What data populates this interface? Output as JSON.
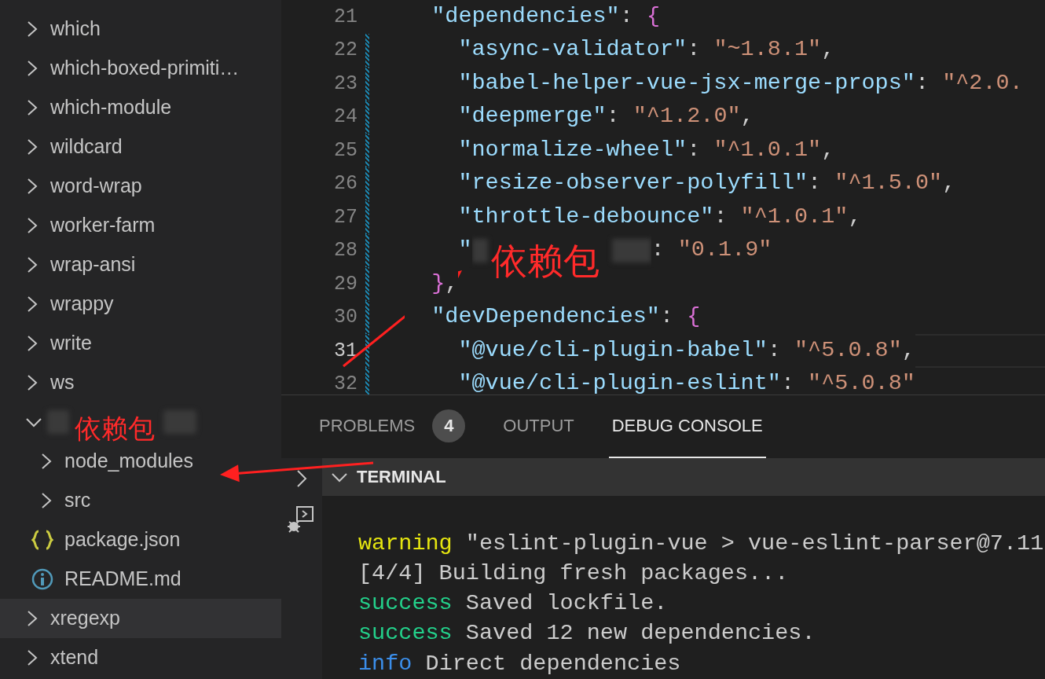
{
  "sidebar": {
    "items": [
      {
        "kind": "folder",
        "label": "which",
        "expanded": false,
        "selected": false
      },
      {
        "kind": "folder",
        "label": "which-boxed-primiti…",
        "expanded": false,
        "selected": false
      },
      {
        "kind": "folder",
        "label": "which-module",
        "expanded": false,
        "selected": false
      },
      {
        "kind": "folder",
        "label": "wildcard",
        "expanded": false,
        "selected": false
      },
      {
        "kind": "folder",
        "label": "word-wrap",
        "expanded": false,
        "selected": false
      },
      {
        "kind": "folder",
        "label": "worker-farm",
        "expanded": false,
        "selected": false
      },
      {
        "kind": "folder",
        "label": "wrap-ansi",
        "expanded": false,
        "selected": false
      },
      {
        "kind": "folder",
        "label": "wrappy",
        "expanded": false,
        "selected": false
      },
      {
        "kind": "folder",
        "label": "write",
        "expanded": false,
        "selected": false
      },
      {
        "kind": "folder",
        "label": "ws",
        "expanded": false,
        "selected": false
      },
      {
        "kind": "redacted",
        "expanded": true,
        "selected": false,
        "children": [
          {
            "kind": "folder",
            "label": "node_modules",
            "expanded": false,
            "selected": false
          },
          {
            "kind": "folder",
            "label": "src",
            "expanded": false,
            "selected": false
          },
          {
            "kind": "json",
            "label": "package.json",
            "selected": false
          },
          {
            "kind": "info",
            "label": "README.md",
            "selected": false
          }
        ]
      },
      {
        "kind": "folder",
        "label": "xregexp",
        "expanded": false,
        "selected": true
      },
      {
        "kind": "folder",
        "label": "xtend",
        "expanded": false,
        "selected": false
      }
    ]
  },
  "editor": {
    "lines": [
      {
        "number": "21",
        "current": false,
        "modified": false,
        "tokens": [
          {
            "kind": "key",
            "text": "  \"dependencies\""
          },
          {
            "kind": "punct",
            "text": ": "
          },
          {
            "kind": "brace",
            "text": "{"
          }
        ]
      },
      {
        "number": "22",
        "current": false,
        "modified": true,
        "tokens": [
          {
            "kind": "key",
            "text": "    \"async-validator\""
          },
          {
            "kind": "punct",
            "text": ": "
          },
          {
            "kind": "string",
            "text": "\"~1.8.1\""
          },
          {
            "kind": "punct",
            "text": ","
          }
        ]
      },
      {
        "number": "23",
        "current": false,
        "modified": true,
        "tokens": [
          {
            "kind": "key",
            "text": "    \"babel-helper-vue-jsx-merge-props\""
          },
          {
            "kind": "punct",
            "text": ": "
          },
          {
            "kind": "string",
            "text": "\"^2.0."
          }
        ]
      },
      {
        "number": "24",
        "current": false,
        "modified": true,
        "tokens": [
          {
            "kind": "key",
            "text": "    \"deepmerge\""
          },
          {
            "kind": "punct",
            "text": ": "
          },
          {
            "kind": "string",
            "text": "\"^1.2.0\""
          },
          {
            "kind": "punct",
            "text": ","
          }
        ]
      },
      {
        "number": "25",
        "current": false,
        "modified": true,
        "tokens": [
          {
            "kind": "key",
            "text": "    \"normalize-wheel\""
          },
          {
            "kind": "punct",
            "text": ": "
          },
          {
            "kind": "string",
            "text": "\"^1.0.1\""
          },
          {
            "kind": "punct",
            "text": ","
          }
        ]
      },
      {
        "number": "26",
        "current": false,
        "modified": true,
        "tokens": [
          {
            "kind": "key",
            "text": "    \"resize-observer-polyfill\""
          },
          {
            "kind": "punct",
            "text": ": "
          },
          {
            "kind": "string",
            "text": "\"^1.5.0\""
          },
          {
            "kind": "punct",
            "text": ","
          }
        ]
      },
      {
        "number": "27",
        "current": false,
        "modified": true,
        "tokens": [
          {
            "kind": "key",
            "text": "    \"throttle-debounce\""
          },
          {
            "kind": "punct",
            "text": ": "
          },
          {
            "kind": "string",
            "text": "\"^1.0.1\""
          },
          {
            "kind": "punct",
            "text": ","
          }
        ]
      },
      {
        "number": "28",
        "current": false,
        "modified": true,
        "tokens": [
          {
            "kind": "key",
            "text": "    \""
          },
          {
            "kind": "redacted"
          },
          {
            "kind": "punct",
            "text": ": "
          },
          {
            "kind": "string",
            "text": "\"0.1.9\""
          }
        ]
      },
      {
        "number": "29",
        "current": false,
        "modified": true,
        "tokens": [
          {
            "kind": "brace",
            "text": "  }"
          },
          {
            "kind": "punct",
            "text": ","
          }
        ]
      },
      {
        "number": "30",
        "current": false,
        "modified": true,
        "tokens": [
          {
            "kind": "key",
            "text": "  \"devDependencies\""
          },
          {
            "kind": "punct",
            "text": ": "
          },
          {
            "kind": "brace",
            "text": "{"
          }
        ]
      },
      {
        "number": "31",
        "current": true,
        "modified": true,
        "tokens": [
          {
            "kind": "key",
            "text": "    \"@vue/cli-plugin-babel\""
          },
          {
            "kind": "punct",
            "text": ": "
          },
          {
            "kind": "string",
            "text": "\"^5.0.8\""
          },
          {
            "kind": "punct",
            "text": ","
          }
        ]
      },
      {
        "number": "32",
        "current": false,
        "modified": true,
        "tokens": [
          {
            "kind": "key",
            "text": "    \"@vue/cli-plugin-eslint\""
          },
          {
            "kind": "punct",
            "text": ": "
          },
          {
            "kind": "string",
            "text": "\"^5.0.8\""
          }
        ]
      }
    ]
  },
  "panel": {
    "tabs": [
      {
        "label": "PROBLEMS",
        "badge": "4",
        "selected": false
      },
      {
        "label": "OUTPUT",
        "selected": false
      },
      {
        "label": "DEBUG CONSOLE",
        "selected": true
      }
    ],
    "terminal": {
      "title": "TERMINAL",
      "expanded": true,
      "lines": [
        [
          {
            "kind": "warning",
            "text": "warning"
          },
          {
            "kind": "plain",
            "text": " \"eslint-plugin-vue > vue-eslint-parser@7.11"
          }
        ],
        [
          {
            "kind": "plain",
            "text": "[4/4] Building fresh packages..."
          }
        ],
        [
          {
            "kind": "success",
            "text": "success"
          },
          {
            "kind": "plain",
            "text": " Saved lockfile."
          }
        ],
        [
          {
            "kind": "success",
            "text": "success"
          },
          {
            "kind": "plain",
            "text": " Saved 12 new dependencies."
          }
        ],
        [
          {
            "kind": "info",
            "text": "info"
          },
          {
            "kind": "plain",
            "text": " Direct dependencies"
          }
        ]
      ]
    }
  },
  "annotations": [
    {
      "kind": "label",
      "text": "依赖包"
    },
    {
      "kind": "label",
      "text": "依赖包"
    },
    {
      "kind": "arrow"
    },
    {
      "kind": "arrow"
    }
  ]
}
